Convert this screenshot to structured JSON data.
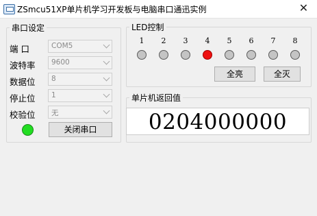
{
  "window": {
    "title": "ZSmcu51XP单片机学习开发板与电脑串口通迅实例",
    "close_glyph": "✕"
  },
  "serial": {
    "group_title": "串口设定",
    "fields": [
      {
        "label": "端  口",
        "value": "COM5"
      },
      {
        "label": "波特率",
        "value": "9600"
      },
      {
        "label": "数据位",
        "value": "8"
      },
      {
        "label": "停止位",
        "value": "1"
      },
      {
        "label": "校验位",
        "value": "无"
      }
    ],
    "status_led_color": "#22dd22",
    "close_button": "关闭串口"
  },
  "led": {
    "group_title": "LED控制",
    "items": [
      {
        "number": "1",
        "on": false
      },
      {
        "number": "2",
        "on": false
      },
      {
        "number": "3",
        "on": false
      },
      {
        "number": "4",
        "on": true
      },
      {
        "number": "5",
        "on": false
      },
      {
        "number": "6",
        "on": false
      },
      {
        "number": "7",
        "on": false
      },
      {
        "number": "8",
        "on": false
      }
    ],
    "on_color": "#ee1111",
    "off_color": "#c4c4c4",
    "all_on_button": "全亮",
    "all_off_button": "全灭"
  },
  "mcu": {
    "group_title": "单片机返回值",
    "value": "0204000000"
  }
}
